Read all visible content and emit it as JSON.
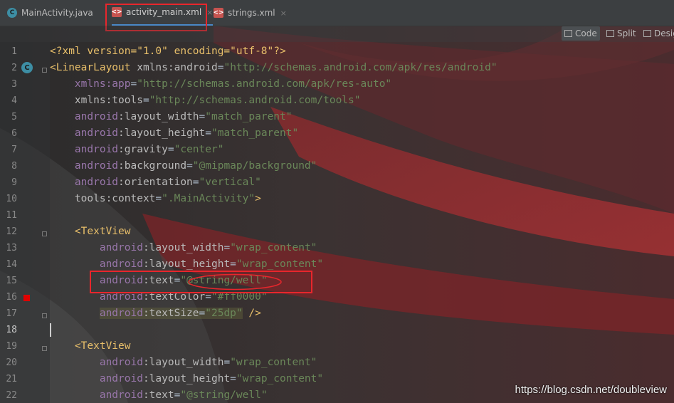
{
  "tabs": [
    {
      "label": "MainActivity.java",
      "icon": "java-class-icon"
    },
    {
      "label": "activity_main.xml",
      "icon": "xml-layout-icon"
    },
    {
      "label": "strings.xml",
      "icon": "xml-file-icon"
    }
  ],
  "close_glyph": "×",
  "view_modes": {
    "code": "Code",
    "split": "Split",
    "design": "Desig"
  },
  "gutter": {
    "class_badge": "C"
  },
  "line_numbers": [
    "1",
    "2",
    "3",
    "4",
    "5",
    "6",
    "7",
    "8",
    "9",
    "10",
    "11",
    "12",
    "13",
    "14",
    "15",
    "16",
    "17",
    "18",
    "19",
    "20",
    "21",
    "22"
  ],
  "code": {
    "l1": {
      "prolog": "<?xml version=\"1.0\" encoding=\"utf-8\"?>"
    },
    "l2": {
      "open": "<LinearLayout",
      "ns": "xmlns:android",
      "eq": "=",
      "val": "\"http://schemas.android.com/apk/res/android\""
    },
    "l3": {
      "attr": "xmlns:app",
      "eq": "=",
      "val": "\"http://schemas.android.com/apk/res-auto\""
    },
    "l4": {
      "attr": "xmlns:tools",
      "eq": "=",
      "val": "\"http://schemas.android.com/tools\""
    },
    "l5": {
      "ns": "android",
      "attr": ":layout_width",
      "eq": "=",
      "val": "\"match_parent\""
    },
    "l6": {
      "ns": "android",
      "attr": ":layout_height",
      "eq": "=",
      "val": "\"match_parent\""
    },
    "l7": {
      "ns": "android",
      "attr": ":gravity",
      "eq": "=",
      "val": "\"center\""
    },
    "l8": {
      "ns": "android",
      "attr": ":background",
      "eq": "=",
      "val": "\"@mipmap/background\""
    },
    "l9": {
      "ns": "android",
      "attr": ":orientation",
      "eq": "=",
      "val": "\"vertical\""
    },
    "l10": {
      "attr": "tools:context",
      "eq": "=",
      "val": "\".MainActivity\"",
      "close": ">"
    },
    "l12": {
      "open": "<TextView"
    },
    "l13": {
      "ns": "android",
      "attr": ":layout_width",
      "eq": "=",
      "val": "\"wrap_content\""
    },
    "l14": {
      "ns": "android",
      "attr": ":layout_height",
      "eq": "=",
      "val": "\"wrap_content\""
    },
    "l15": {
      "ns": "android",
      "attr": ":text",
      "eq": "=",
      "q1": "\"",
      "val": "@string/well",
      "q2": "\""
    },
    "l16": {
      "ns": "android",
      "attr": ":textColor",
      "eq": "=",
      "val": "\"#ff0000\""
    },
    "l17": {
      "ns": "android",
      "attr": ":textSize",
      "eq": "=",
      "val": "\"25dp\"",
      "close": " />"
    },
    "l19": {
      "open": "<TextView"
    },
    "l20": {
      "ns": "android",
      "attr": ":layout_width",
      "eq": "=",
      "val": "\"wrap_content\""
    },
    "l21": {
      "ns": "android",
      "attr": ":layout_height",
      "eq": "=",
      "val": "\"wrap_content\""
    },
    "l22": {
      "ns": "android",
      "attr": ":text",
      "eq": "=",
      "val": "\"@string/well\""
    }
  },
  "watermark": "https://blog.csdn.net/doubleview",
  "colors": {
    "annotation_red": "#e8262c",
    "xml_tag": "#e8bf6a",
    "xml_value": "#6a8759",
    "namespace": "#9876aa"
  }
}
